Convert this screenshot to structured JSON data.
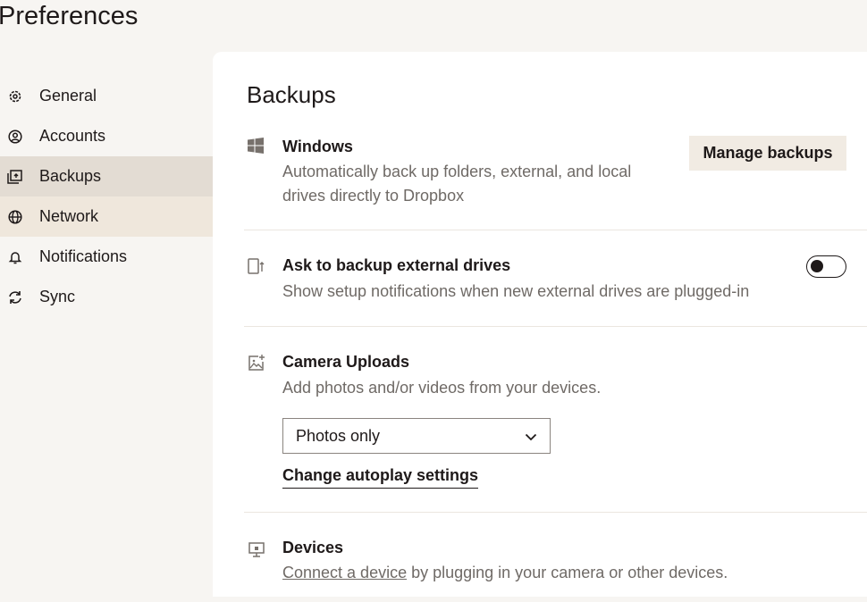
{
  "title": "Preferences",
  "sidebar": {
    "items": [
      {
        "label": "General",
        "icon": "gear-icon"
      },
      {
        "label": "Accounts",
        "icon": "account-icon"
      },
      {
        "label": "Backups",
        "icon": "backup-icon",
        "selected": true
      },
      {
        "label": "Network",
        "icon": "globe-icon"
      },
      {
        "label": "Notifications",
        "icon": "bell-icon"
      },
      {
        "label": "Sync",
        "icon": "sync-icon"
      }
    ]
  },
  "main": {
    "heading": "Backups",
    "windows": {
      "title": "Windows",
      "desc1": "Automatically back up folders, external, and local",
      "desc2": "drives directly to Dropbox",
      "button": "Manage backups"
    },
    "external": {
      "title": "Ask to backup external drives",
      "desc": "Show setup notifications when new external drives are plugged-in",
      "toggle_on": false
    },
    "camera": {
      "title": "Camera Uploads",
      "desc": "Add photos and/or videos from your devices.",
      "select_value": "Photos only",
      "link": "Change autoplay settings"
    },
    "devices": {
      "title": "Devices",
      "link": "Connect a device",
      "desc": " by plugging in your camera or other devices."
    }
  }
}
